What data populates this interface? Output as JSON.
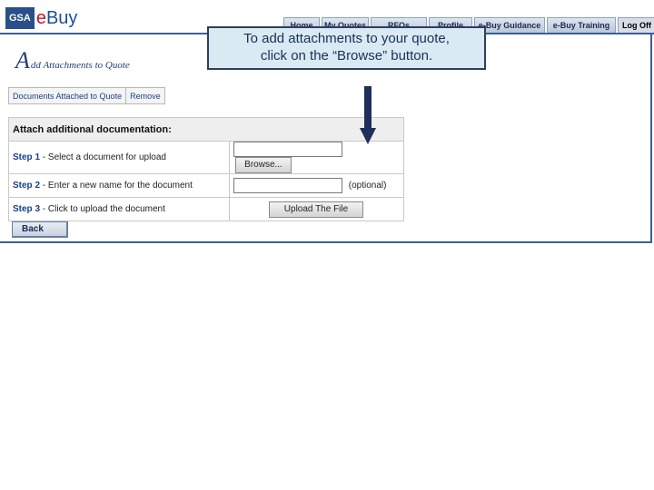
{
  "header": {
    "logo": {
      "gsa": "GSA",
      "ebuy_e": "e",
      "ebuy_rest": "Buy"
    },
    "tabs": [
      {
        "label": "Home"
      },
      {
        "label": "My Quotes"
      },
      {
        "label": "RFQs"
      },
      {
        "label": "Profile"
      },
      {
        "label": "e-Buy Guidance"
      },
      {
        "label": "e-Buy Training"
      },
      {
        "label": "Log Off"
      }
    ]
  },
  "page": {
    "title_initial": "A",
    "title_rest": "dd Attachments to Quote"
  },
  "subnav": {
    "items": [
      {
        "label": "Documents Attached to Quote"
      },
      {
        "label": "Remove"
      }
    ]
  },
  "form": {
    "heading": "Attach additional documentation:",
    "steps": [
      {
        "step": "Step 1",
        "text": "- Select a document for upload",
        "button": "Browse..."
      },
      {
        "step": "Step 2",
        "text": "- Enter a new name for the document",
        "note": "(optional)"
      },
      {
        "step": "Step 3",
        "text": "- Click to upload the document",
        "button": "Upload The File"
      }
    ]
  },
  "back_button": {
    "label": "Back"
  },
  "callout": {
    "line1": "To add attachments to your quote,",
    "line2": "click on the “Browse” button."
  },
  "colors": {
    "brand": "#2a4f8a",
    "accent": "#c8102e",
    "callout_bg": "#d9eaf2",
    "arrow": "#1e2f5a"
  }
}
